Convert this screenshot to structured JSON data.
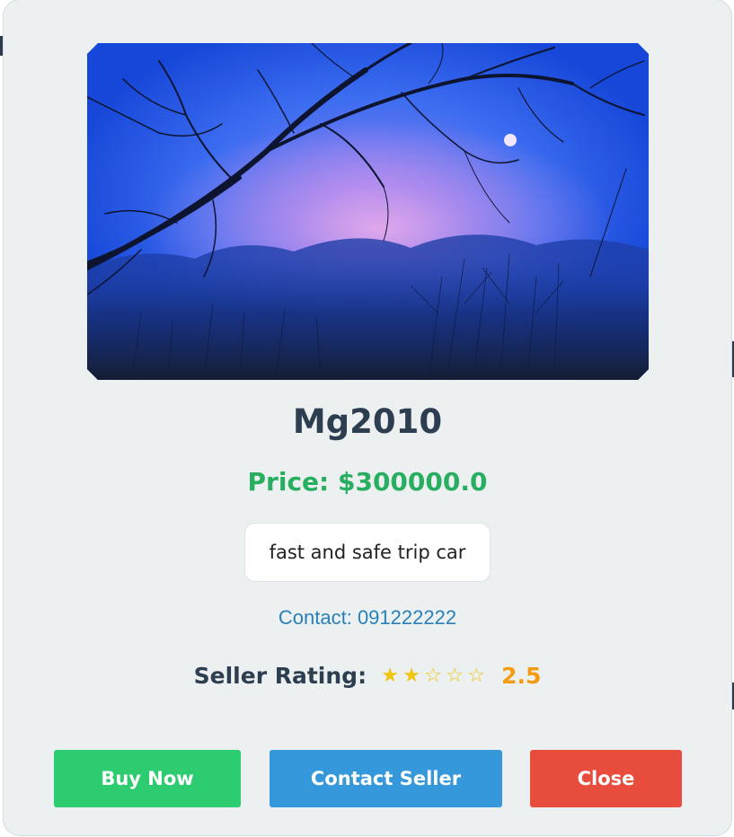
{
  "product": {
    "title": "Mg2010",
    "price": "Price: $300000.0",
    "description": "fast and safe trip car",
    "contact": "Contact: 091222222",
    "image_alt": "Silhouetted tree branches against a blue and pink twilight sky with the moon"
  },
  "rating": {
    "label": "Seller Rating:",
    "value_text": "2.5",
    "value": 2.5,
    "max": 5,
    "stars": [
      "★",
      "★",
      "☆",
      "☆",
      "☆"
    ]
  },
  "buttons": {
    "buy": "Buy Now",
    "contact": "Contact Seller",
    "close": "Close"
  },
  "colors": {
    "title": "#2c3e50",
    "price": "#27ae60",
    "contact": "#2980b9",
    "star": "#f1c40f",
    "rating_value": "#f39c12",
    "buy": "#2ecc71",
    "contact_button": "#3498db",
    "close": "#e74c3c",
    "modal_bg": "#ecf0f1"
  }
}
